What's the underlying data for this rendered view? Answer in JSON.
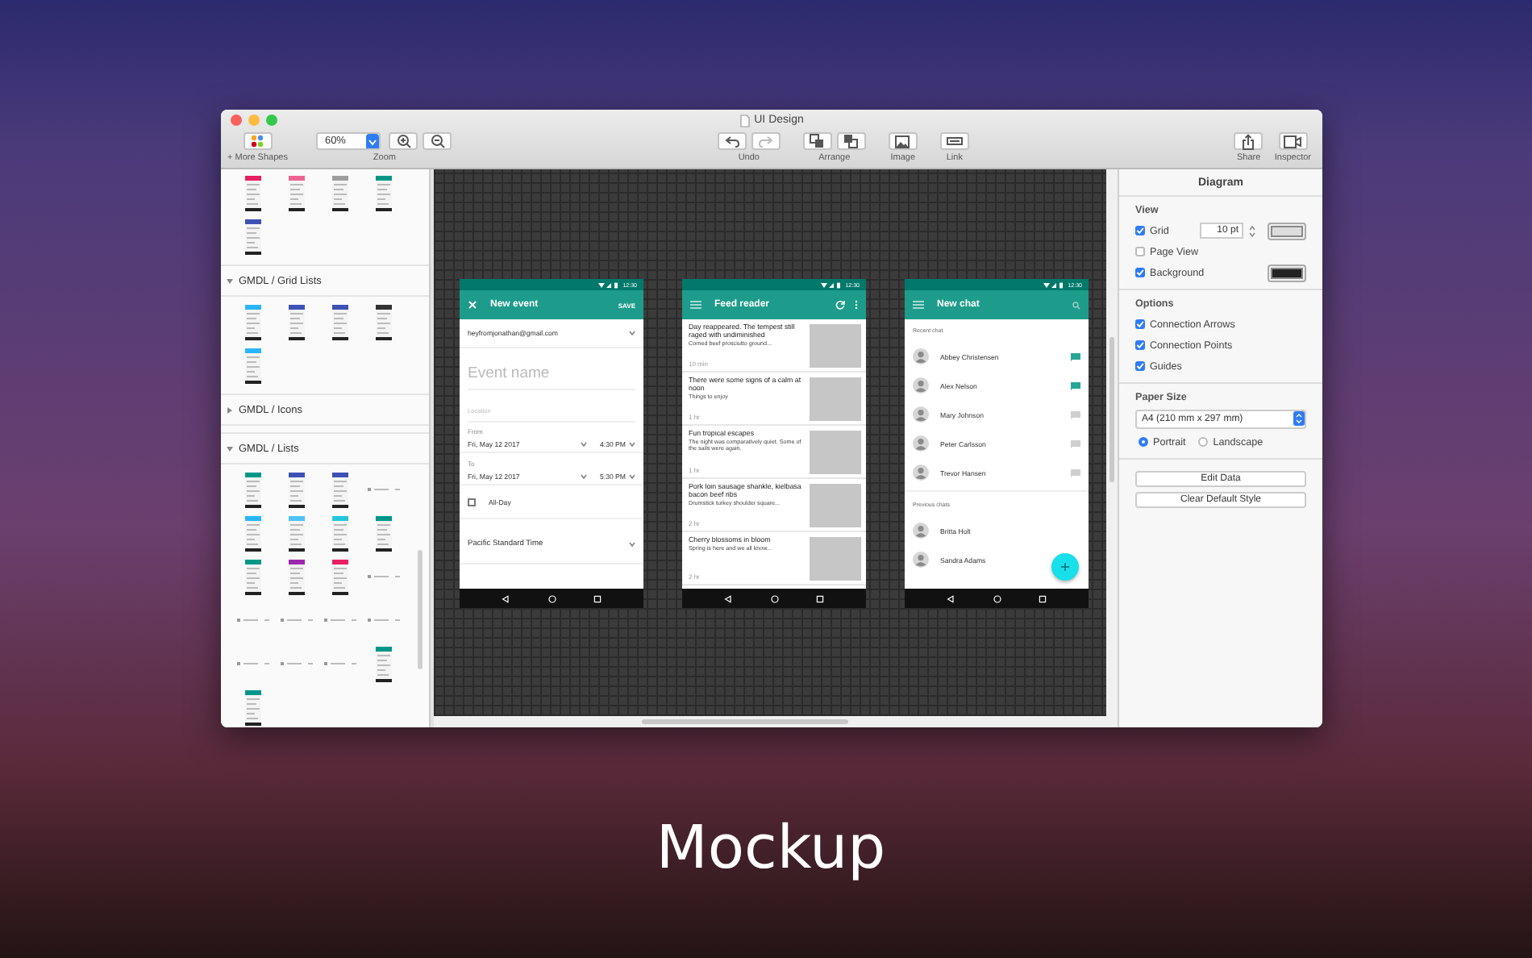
{
  "window": {
    "title": "UI Design"
  },
  "toolbar": {
    "left": [
      {
        "kind": "more-shapes",
        "label": "+ More Shapes"
      },
      {
        "kind": "zoom",
        "value": "60%",
        "label": "Zoom"
      }
    ],
    "center": [
      {
        "kind": "undo",
        "label": "Undo",
        "buttons": [
          {
            "disabled": false
          },
          {
            "disabled": true
          }
        ]
      },
      {
        "kind": "arrange",
        "label": "Arrange"
      },
      {
        "kind": "image",
        "label": "Image"
      },
      {
        "kind": "link",
        "label": "Link"
      }
    ],
    "right": [
      {
        "kind": "share",
        "label": "Share"
      },
      {
        "kind": "inspector",
        "label": "Inspector"
      }
    ]
  },
  "sidebar": {
    "sections": [
      {
        "thumbnails": [
          {
            "kind": "screen",
            "color": "#e91e63"
          },
          {
            "kind": "screen",
            "color": "#f06292"
          },
          {
            "kind": "screen",
            "color": "#9e9e9e"
          },
          {
            "kind": "screen",
            "color": "#009688"
          },
          {
            "kind": "screen",
            "color": "#3f51b5"
          }
        ]
      },
      {
        "title": "GMDL / Grid Lists",
        "expanded": true,
        "thumbnails": [
          {
            "kind": "screen",
            "color": "#29b6f6"
          },
          {
            "kind": "screen",
            "color": "#3f51b5"
          },
          {
            "kind": "screen",
            "color": "#3f51b5"
          },
          {
            "kind": "screen",
            "color": "#333333"
          },
          {
            "kind": "screen",
            "color": "#29b6f6"
          }
        ]
      },
      {
        "title": "GMDL / Icons",
        "expanded": false
      },
      {
        "title": "GMDL / Lists",
        "expanded": true,
        "thumbnails": [
          {
            "kind": "screen",
            "color": "#009688"
          },
          {
            "kind": "screen",
            "color": "#3f51b5"
          },
          {
            "kind": "screen",
            "color": "#3f51b5"
          },
          {
            "kind": "row"
          },
          {
            "kind": "screen",
            "color": "#29b6f6"
          },
          {
            "kind": "screen",
            "color": "#4fc3f7"
          },
          {
            "kind": "screen",
            "color": "#26c6da"
          },
          {
            "kind": "screen",
            "color": "#009688"
          },
          {
            "kind": "screen",
            "color": "#009688"
          },
          {
            "kind": "screen",
            "color": "#9c27b0"
          },
          {
            "kind": "screen",
            "color": "#e91e63"
          },
          {
            "kind": "row"
          },
          {
            "kind": "row"
          },
          {
            "kind": "row"
          },
          {
            "kind": "row"
          },
          {
            "kind": "row"
          },
          {
            "kind": "row"
          },
          {
            "kind": "row"
          },
          {
            "kind": "row"
          },
          {
            "kind": "screen",
            "color": "#009688"
          },
          {
            "kind": "screen",
            "color": "#009688"
          }
        ]
      }
    ]
  },
  "canvas": {
    "phones": [
      {
        "kind": "event",
        "time": "12:30",
        "title": "New event",
        "action": "SAVE",
        "account": "heyfromjonathan@gmail.com",
        "name_placeholder": "Event name",
        "location_placeholder": "Location",
        "from": {
          "label": "From",
          "date": "Fri, May 12 2017",
          "time": "4:30 PM"
        },
        "to": {
          "label": "To",
          "date": "Fri, May 12 2017",
          "time": "5:30 PM"
        },
        "all_day": {
          "label": "All-Day",
          "checked": false
        },
        "timezone": "Pacific Standard Time"
      },
      {
        "kind": "feed",
        "time": "12:30",
        "title": "Feed reader",
        "items": [
          {
            "title": "Day reappeared. The tempest still raged with undiminished",
            "snippet": "Corned beef prosciutto ground...",
            "age": "10 min"
          },
          {
            "title": "There were some signs of a calm at noon",
            "snippet": "Things to enjoy",
            "age": "1 hr"
          },
          {
            "title": "Fun tropical escapes",
            "snippet": "The night was comparatively quiet. Some of the sails were again.",
            "age": "1 hr"
          },
          {
            "title": "Pork loin sausage shankle, kielbasa bacon beef ribs",
            "snippet": "Drumstick turkey shoulder square...",
            "age": "2 hr"
          },
          {
            "title": "Cherry blossoms in bloom",
            "snippet": "Spring is here and we all know...",
            "age": "2 hr"
          }
        ]
      },
      {
        "kind": "chat",
        "time": "12:30",
        "title": "New chat",
        "sections": [
          {
            "title": "Recent chat",
            "contacts": [
              {
                "name": "Abbey Christensen",
                "active": true
              },
              {
                "name": "Alex Nelson",
                "active": true
              },
              {
                "name": "Mary Johnson",
                "active": false
              },
              {
                "name": "Peter Carlsson",
                "active": false
              },
              {
                "name": "Trevor Hansen",
                "active": false
              }
            ]
          },
          {
            "title": "Previous chats",
            "contacts": [
              {
                "name": "Britta Holt"
              },
              {
                "name": "Sandra Adams"
              }
            ]
          }
        ]
      }
    ]
  },
  "inspector": {
    "title": "Diagram",
    "sections": [
      {
        "kind": "checks",
        "title": "View",
        "rows": [
          {
            "label": "Grid",
            "checked": true,
            "stepper": "10 pt",
            "color": "#dcdcdc"
          },
          {
            "label": "Page View",
            "checked": false
          },
          {
            "label": "Background",
            "checked": true,
            "color": "#222222"
          }
        ]
      },
      {
        "kind": "checks",
        "title": "Options",
        "rows": [
          {
            "label": "Connection Arrows",
            "checked": true
          },
          {
            "label": "Connection Points",
            "checked": true
          },
          {
            "label": "Guides",
            "checked": true
          }
        ]
      },
      {
        "kind": "paper",
        "title": "Paper Size",
        "select": "A4 (210 mm x 297 mm)",
        "radios": [
          {
            "label": "Portrait",
            "selected": true
          },
          {
            "label": "Landscape",
            "selected": false
          }
        ]
      },
      {
        "kind": "actions",
        "buttons": [
          "Edit Data",
          "Clear Default Style"
        ]
      }
    ]
  },
  "caption": "Mockup"
}
